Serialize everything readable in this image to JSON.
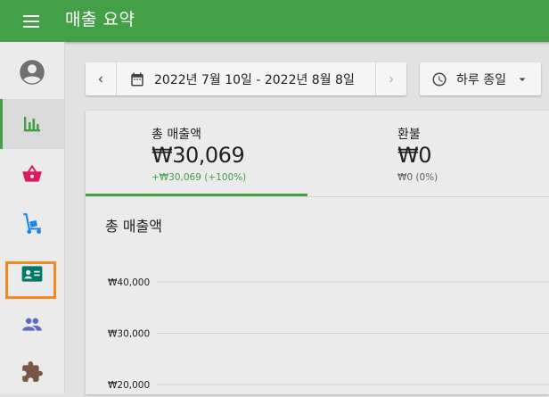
{
  "header": {
    "title": "매출 요약",
    "menu_icon": "hamburger-menu-icon",
    "color": "#43a047"
  },
  "sidebar": {
    "items": [
      {
        "name": "account",
        "icon": "account-circle-icon",
        "color": "#707070",
        "active": false
      },
      {
        "name": "reports",
        "icon": "bar-chart-icon",
        "color": "#43a047",
        "active": true
      },
      {
        "name": "shop",
        "icon": "basket-icon",
        "color": "#d81b60",
        "active": false
      },
      {
        "name": "delivery",
        "icon": "hand-truck-icon",
        "color": "#1e88e5",
        "active": false
      },
      {
        "name": "contacts",
        "icon": "id-card-icon",
        "color": "#00796b",
        "active": false
      },
      {
        "name": "customers",
        "icon": "people-icon",
        "color": "#5c6bc0",
        "active": false,
        "highlighted": true
      },
      {
        "name": "extensions",
        "icon": "puzzle-icon",
        "color": "#795548",
        "active": false
      }
    ]
  },
  "toolbar": {
    "prev_icon": "chevron-left-icon",
    "next_icon": "chevron-right-icon",
    "calendar_icon": "calendar-icon",
    "date_range": "2022년 7월 10일 - 2022년 8월 8일",
    "time_icon": "clock-icon",
    "time_range": "하루 종일",
    "dropdown_icon": "dropdown-arrow-icon"
  },
  "summary": {
    "tabs": [
      {
        "label": "총 매출액",
        "value": "₩30,069",
        "delta": "+₩30,069 (+100%)",
        "active": true
      },
      {
        "label": "환불",
        "value": "₩0",
        "delta": "₩0 (0%)",
        "active": false
      }
    ]
  },
  "chart_data": {
    "type": "line",
    "title": "총 매출액",
    "y_tick_labels": [
      "₩40,000",
      "₩30,000",
      "₩20,000"
    ],
    "y_ticks": [
      40000,
      30000,
      20000
    ],
    "grid": true
  }
}
